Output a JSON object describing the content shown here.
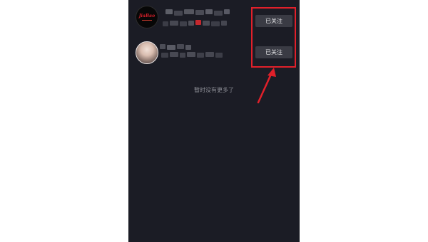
{
  "following_list": {
    "items": [
      {
        "avatar_logo_text": "JiaBao",
        "follow_button_label": "已关注"
      },
      {
        "follow_button_label": "已关注"
      }
    ],
    "end_message": "暂时没有更多了"
  },
  "colors": {
    "background": "#1b1c25",
    "button_bg": "#3a3b44",
    "highlight": "#e1202a"
  }
}
